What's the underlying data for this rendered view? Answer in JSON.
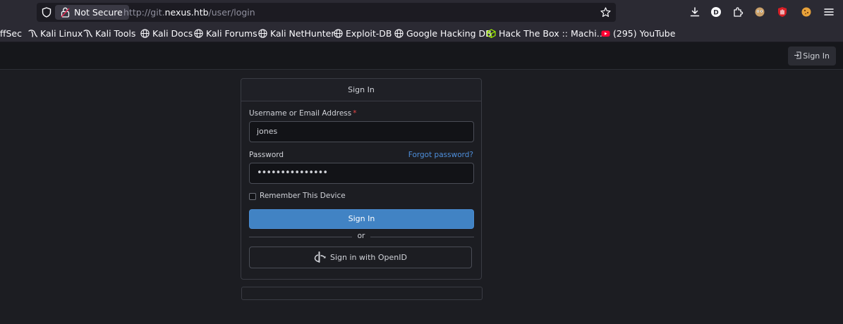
{
  "browser": {
    "security_label": "Not Secure",
    "url_prefix": "http://git.",
    "url_domain": "nexus.htb",
    "url_path": "/user/login"
  },
  "bookmarks": [
    {
      "label": "OffSec",
      "icon": "offsec-icon"
    },
    {
      "label": "Kali Linux",
      "icon": "kali-dragon-icon"
    },
    {
      "label": "Kali Tools",
      "icon": "kali-dragon-icon"
    },
    {
      "label": "Kali Docs",
      "icon": "globe-icon"
    },
    {
      "label": "Kali Forums",
      "icon": "globe-icon"
    },
    {
      "label": "Kali NetHunter",
      "icon": "globe-icon"
    },
    {
      "label": "Exploit-DB",
      "icon": "globe-icon"
    },
    {
      "label": "Google Hacking DB",
      "icon": "globe-icon"
    },
    {
      "label": "Hack The Box :: Machi…",
      "icon": "htb-cube-icon"
    },
    {
      "label": "(295) YouTube",
      "icon": "youtube-icon"
    }
  ],
  "nav": {
    "signin_label": "Sign In"
  },
  "login": {
    "title": "Sign In",
    "username_label": "Username or Email Address",
    "required_marker": "*",
    "username_value": "jones",
    "password_label": "Password",
    "forgot_label": "Forgot password?",
    "password_value": "•••••••••••••••",
    "remember_label": "Remember This Device",
    "submit_label": "Sign In",
    "or_label": "or",
    "openid_label": "Sign in with OpenID"
  },
  "colors": {
    "accent": "#4183c4",
    "link": "#4e8fdc",
    "required": "#e54545",
    "background": "#1c1d22"
  }
}
